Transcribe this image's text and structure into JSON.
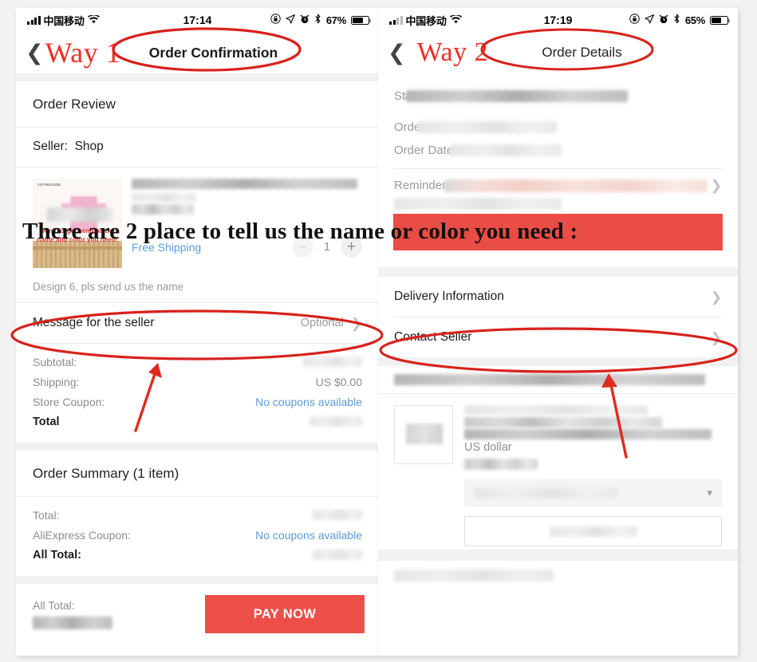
{
  "annotation": {
    "overlay_text": "There are 2 place to tell us the name or color you need :",
    "way1_label": "Way 1",
    "way2_label": "Way 2",
    "accent_red": "#ee2d24",
    "banner_red": "#ea4c46",
    "circle_color": "#d8221c",
    "arrow_color": "#e02a20"
  },
  "left_phone": {
    "status": {
      "carrier": "中国移动",
      "wifi_icon": "wifi-icon",
      "time": "17:14",
      "rotation_lock_icon": "rotation-lock-icon",
      "location_icon": "location-arrow-icon",
      "alarm_icon": "alarm-clock-icon",
      "bluetooth_icon": "bluetooth-icon",
      "battery_percent": "67%",
      "battery_icon": "battery-icon"
    },
    "nav": {
      "back_icon": "chevron-left-icon",
      "title": "Order Confirmation"
    },
    "order_review": {
      "heading": "Order Review",
      "seller_label": "Seller:",
      "seller_name": "Shop",
      "product": {
        "thumb_brand": "JOYRESIDE",
        "thumb_caption": "Don't forget send us the name and color you need!",
        "title_redacted": true,
        "shipping_label": "Free Shipping",
        "qty_minus_icon": "minus-icon",
        "qty_value": "1",
        "qty_plus_icon": "plus-icon"
      },
      "note": "Design 6, pls send us the name",
      "message_row": {
        "label": "Message for the seller",
        "value": "Optional",
        "chevron_icon": "chevron-right-icon"
      },
      "totals": [
        {
          "label": "Subtotal:",
          "value": "",
          "redacted": true,
          "link": false
        },
        {
          "label": "Shipping:",
          "value": "US $0.00",
          "redacted": false,
          "link": false
        },
        {
          "label": "Store Coupon:",
          "value": "No coupons available",
          "redacted": false,
          "link": true
        },
        {
          "label": "Total",
          "value": "",
          "redacted": true,
          "link": false,
          "strong": true
        }
      ]
    },
    "order_summary": {
      "heading": "Order Summary (1 item)",
      "rows": [
        {
          "label": "Total:",
          "value": "",
          "redacted": true,
          "link": false
        },
        {
          "label": "AliExpress Coupon:",
          "value": "No coupons available",
          "redacted": false,
          "link": true
        },
        {
          "label": "All Total:",
          "value": "",
          "redacted": true,
          "link": false,
          "strong": true
        }
      ]
    },
    "pay_bar": {
      "label": "All Total:",
      "amount_redacted": true,
      "button_label": "PAY NOW"
    }
  },
  "right_phone": {
    "status": {
      "carrier": "中国移动",
      "wifi_icon": "wifi-icon",
      "time": "17:19",
      "rotation_lock_icon": "rotation-lock-icon",
      "location_icon": "location-arrow-icon",
      "alarm_icon": "alarm-clock-icon",
      "bluetooth_icon": "bluetooth-icon",
      "battery_percent": "65%",
      "battery_icon": "battery-icon"
    },
    "nav": {
      "back_icon": "chevron-left-icon",
      "title": "Order Details"
    },
    "details": [
      {
        "label": "Status:",
        "redacted": true
      },
      {
        "label": "Orde",
        "redacted": true
      },
      {
        "label": "Order Date",
        "redacted": true
      }
    ],
    "reminder": {
      "label": "Reminder:",
      "redacted": true,
      "chevron_icon": "chevron-right-icon"
    },
    "links": [
      {
        "label": "Delivery Information",
        "chevron_icon": "chevron-right-icon"
      },
      {
        "label": "Contact Seller",
        "chevron_icon": "chevron-right-icon"
      }
    ],
    "product": {
      "title_redacted": true,
      "currency_note": "US dollar",
      "qty_redacted": true,
      "select_chevron_icon": "chevron-down-icon"
    }
  }
}
